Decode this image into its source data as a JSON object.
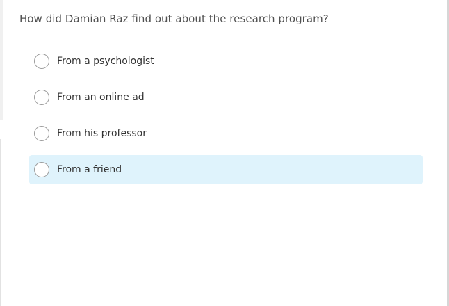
{
  "question": {
    "text": "How did Damian Raz find out about the research program?"
  },
  "options": [
    {
      "label": "From a psychologist",
      "selected": false
    },
    {
      "label": "From an online ad",
      "selected": false
    },
    {
      "label": "From his professor",
      "selected": false
    },
    {
      "label": "From a friend",
      "selected": false,
      "hovered": true
    }
  ],
  "colors": {
    "hover_background": "#dff3fc",
    "radio_border": "#9a9a9a",
    "question_text": "#505050",
    "option_text": "#333333"
  }
}
